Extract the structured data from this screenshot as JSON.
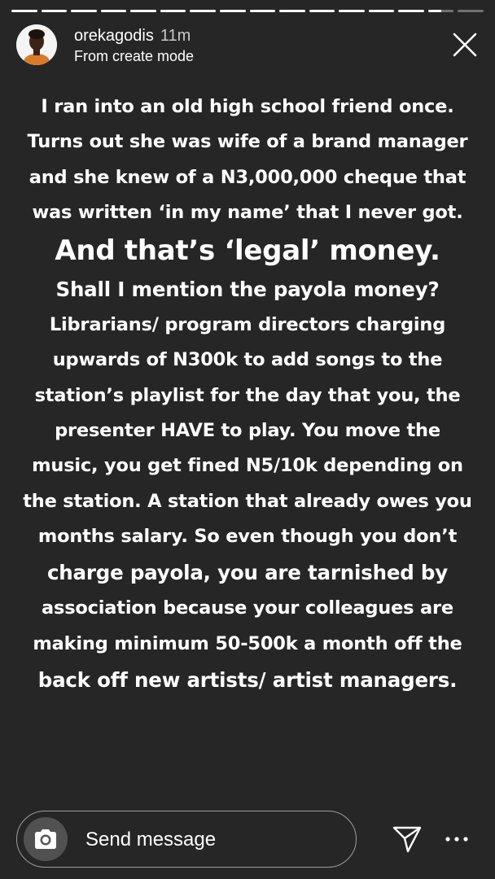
{
  "progress": {
    "segments": [
      1,
      1,
      1,
      1,
      1,
      1,
      1,
      1,
      1,
      1,
      1,
      1,
      1,
      1,
      0.5,
      0
    ]
  },
  "header": {
    "username": "orekagodis",
    "time_ago": "11m",
    "subtitle": "From create mode"
  },
  "story": {
    "lines": [
      "I ran into an old high school friend once.",
      "Turns out she was wife of a brand manager",
      "and she knew of  a N3,000,000 cheque that",
      "was written ‘in my name’ that I never got.",
      "And that’s ‘legal’ money.",
      "Shall I mention the payola money?",
      "Librarians/ program directors charging",
      "upwards of N300k to add songs to the",
      "station’s playlist for the day that you, the",
      "presenter HAVE to play. You move the",
      "music, you get fined N5/10k depending on",
      "the station. A station that already owes you",
      "months salary. So even though you don’t",
      "charge payola, you are tarnished by",
      "association because your colleagues are",
      "making minimum 50-500k a month off the",
      "back off new artists/ artist managers."
    ]
  },
  "reply": {
    "placeholder": "Send message"
  },
  "icons": {
    "close": "close-icon",
    "camera": "camera-icon",
    "send": "send-icon",
    "more": "more-icon"
  }
}
